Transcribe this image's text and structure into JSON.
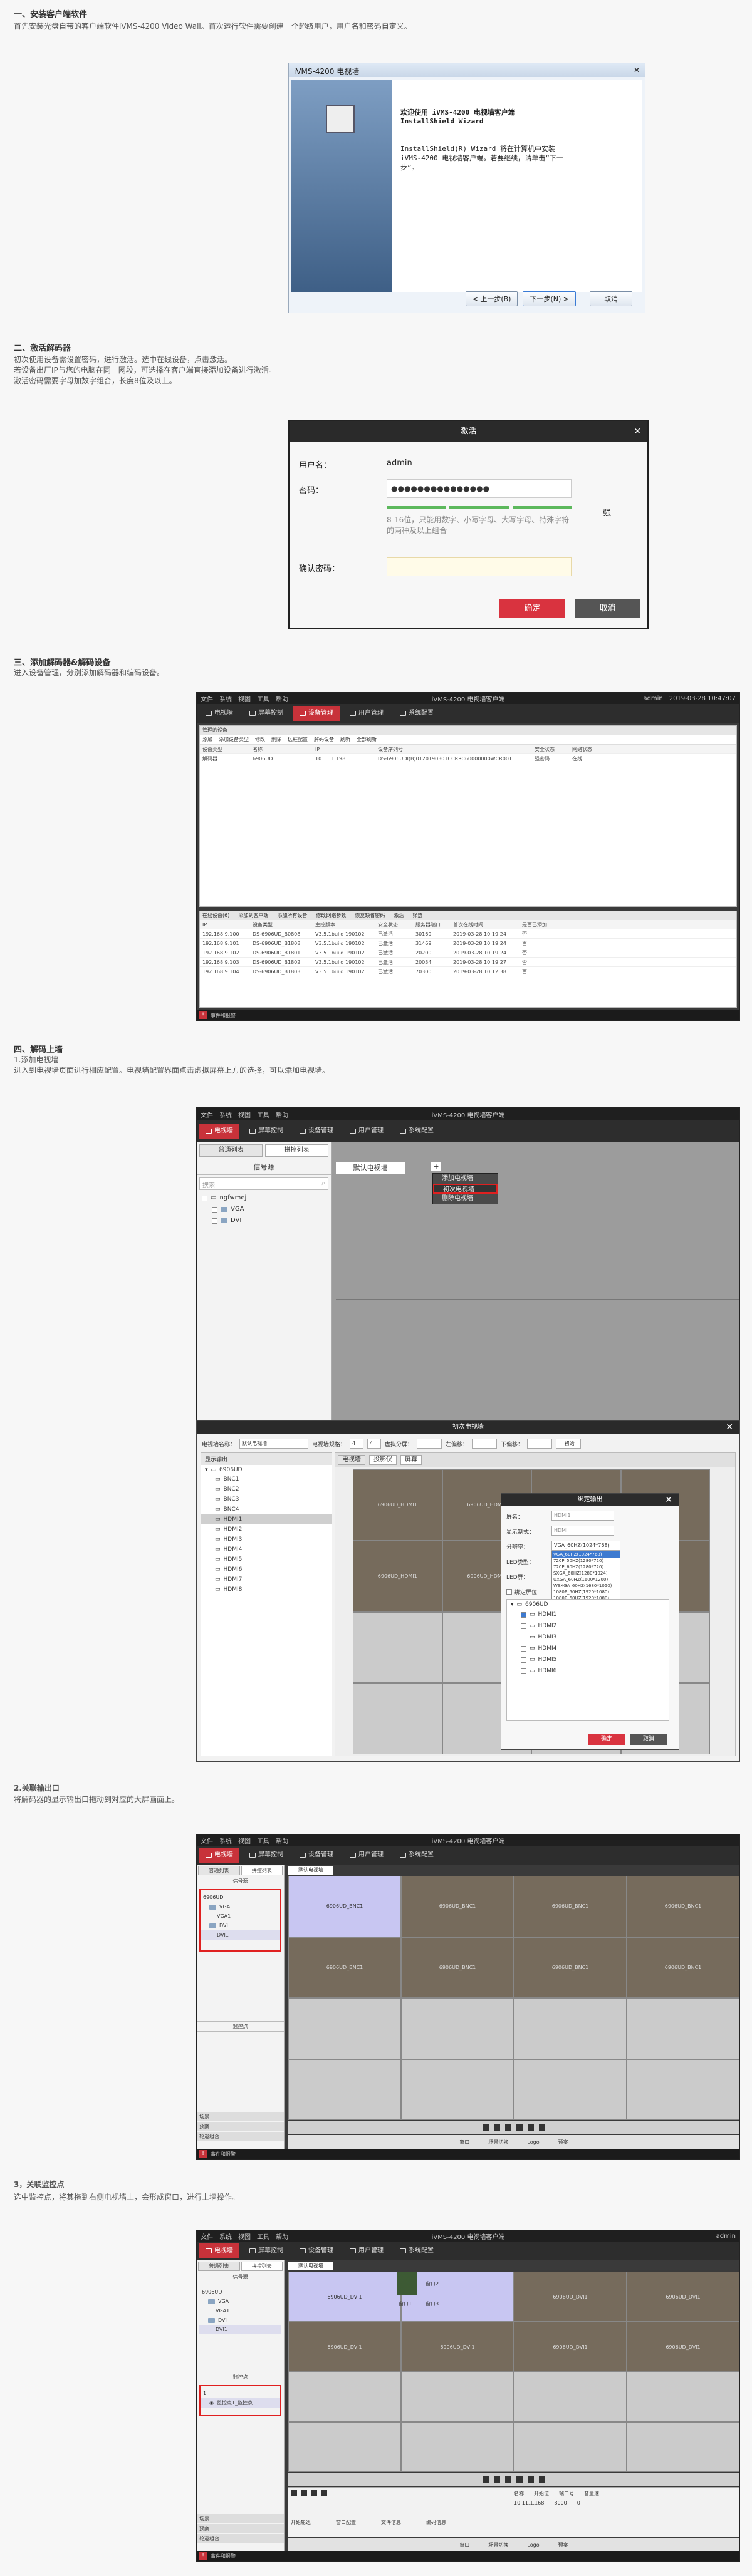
{
  "section1": {
    "heading": "一、安装客户端软件",
    "desc": "首先安装光盘自带的客户端软件iVMS-4200 Video Wall。首次运行软件需要创建一个超级用户，用户名和密码自定义。",
    "installer": {
      "title": "iVMS-4200 电视墙",
      "close": "✕",
      "welcome": "欢迎使用 iVMS-4200 电视墙客户端 InstallShield Wizard",
      "body": "InstallShield(R) Wizard 将在计算机中安装 iVMS-4200 电视墙客户端。若要继续，请单击“下一步”。",
      "back": "< 上一步(B)",
      "next": "下一步(N) >",
      "cancel": "取消"
    }
  },
  "section2": {
    "heading": "二、激活解码器",
    "desc1": "初次使用设备需设置密码，进行激活。选中在线设备，点击激活。",
    "desc2": "若设备出厂IP与您的电脑在同一网段，可选择在客户端直接添加设备进行激活。",
    "desc3": "激活密码需要字母加数字组合，长度8位及以上。",
    "dialog": {
      "title": "激活",
      "close": "✕",
      "user_label": "用户名：",
      "user_value": "admin",
      "pwd_label": "密码：",
      "pwd_value": "●●●●●●●●●●●●●●●",
      "strength": "强",
      "hint": "8-16位，只能用数字、小写字母、大写字母、特殊字符的两种及以上组合",
      "confirm_label": "确认密码：",
      "ok": "确定",
      "cancel": "取消"
    }
  },
  "section3": {
    "heading": "三、添加解码器&解码设备",
    "desc": "进入设备管理，分别添加解码器和编码设备。",
    "app": {
      "menu": [
        "文件",
        "系统",
        "视图",
        "工具",
        "帮助"
      ],
      "title": "iVMS-4200 电视墙客户端",
      "user": "admin",
      "time": "2019-03-28 10:47:07",
      "nav": [
        "电视墙",
        "屏幕控制",
        "设备管理",
        "用户管理",
        "系统配置"
      ],
      "upper_tab": "管理的设备",
      "upper_buttons": [
        "添加",
        "添加设备类型",
        "修改",
        "删除",
        "远程配置",
        "解码设备",
        "刷新",
        "全部刷新"
      ],
      "upper_headers": [
        "设备类型",
        "名称",
        "IP",
        "设备序列号",
        "安全状态",
        "网络状态"
      ],
      "upper_rows": [
        [
          "解码器",
          "6906UD",
          "10.11.1.198",
          "DS-6906UDI(B)0120190301CCRRC60000000WCR001",
          "强密码",
          "在线"
        ]
      ],
      "lower_tab": "在线设备(6)",
      "lower_buttons": [
        "添加到客户端",
        "添加所有设备",
        "修改网络参数",
        "恢复缺省密码",
        "激活",
        "筛选"
      ],
      "lower_headers": [
        "IP",
        "设备类型",
        "主控版本",
        "安全状态",
        "服务器端口",
        "首次在线时间",
        "是否已添加"
      ],
      "lower_rows": [
        [
          "192.168.9.100",
          "DS-6906UD_B0808",
          "V3.5.1build 190102",
          "已激活",
          "30169",
          "2019-03-28 10:19:24",
          "否"
        ],
        [
          "192.168.9.101",
          "DS-6906UD_B1808",
          "V3.5.1build 190102",
          "已激活",
          "31469",
          "2019-03-28 10:19:24",
          "否"
        ],
        [
          "192.168.9.102",
          "DS-6906UD_B1801",
          "V3.5.1build 190102",
          "已激活",
          "20200",
          "2019-03-28 10:19:24",
          "否"
        ],
        [
          "192.168.9.103",
          "DS-6906UD_B1802",
          "V3.5.1build 190102",
          "已激活",
          "20034",
          "2019-03-28 10:19:27",
          "否"
        ],
        [
          "192.168.9.104",
          "DS-6906UD_B1803",
          "V3.5.1build 190102",
          "已激活",
          "70300",
          "2019-03-28 10:12:38",
          "否"
        ]
      ],
      "footer": "事件和报警"
    }
  },
  "section4": {
    "heading": "四、解码上墙",
    "sub1": "1.添加电视墙",
    "desc1": "进入到电视墙页面进行相应配置。电视墙配置界面点击虚拟屏幕上方的选择，可以添加电视墙。",
    "wall": {
      "menu": [
        "文件",
        "系统",
        "视图",
        "工具",
        "帮助"
      ],
      "title": "iVMS-4200 电视墙客户端",
      "nav": [
        "电视墙",
        "屏幕控制",
        "设备管理",
        "用户管理",
        "系统配置"
      ],
      "tabs": [
        "普通列表",
        "拼控列表"
      ],
      "signal": "信号源",
      "search": "搜索",
      "tree": [
        "ngfwmej",
        "VGA",
        "DVI"
      ],
      "wall_tab": "默认电视墙",
      "add": "+",
      "ctx": [
        "添加电视墙",
        "初次电视墙",
        "删除电视墙"
      ]
    },
    "init": {
      "title": "初次电视墙",
      "close": "✕",
      "name_label": "电视墙名称：",
      "name_value": "默认电视墙",
      "size_label": "电视墙规格：",
      "rows": "4",
      "cols": "4",
      "layout_label": "虚拟分屏：",
      "top_label": "左偏移：",
      "bottom_label": "下偏移：",
      "init_button": "初始",
      "tree_title": "显示输出",
      "device": "6906UD",
      "outputs": [
        "BNC1",
        "BNC2",
        "BNC3",
        "BNC4",
        "HDMI1",
        "HDMI2",
        "HDMI3",
        "HDMI4",
        "HDMI5",
        "HDMI6",
        "HDMI7",
        "HDMI8"
      ],
      "tabs": [
        "电视墙",
        "投影仪",
        "屏幕"
      ],
      "cell_label": "6906UD_HDMI1",
      "submodal": {
        "title": "绑定输出",
        "close": "✕",
        "name_label": "屏名：",
        "name_value": "HDMI1",
        "mode_label": "显示制式：",
        "mode_value": "HDMI",
        "res_label": "分辨率：",
        "res_value": "VGA_60HZ(1024*768)",
        "led_label": "LED类型：",
        "led2_label": "LED屏：",
        "bind_label": "绑定屏位",
        "res_options": [
          "VGA_60HZ(1024*768)",
          "720P_50HZ(1280*720)",
          "720P_60HZ(1280*720)",
          "SXGA_60HZ(1280*1024)",
          "UXGA_60HZ(1600*1200)",
          "WSXGA_60HZ(1680*1050)",
          "1080P_50HZ(1920*1080)",
          "1080P_60HZ(1920*1080)",
          "4K_30HZ(3840*2160)"
        ],
        "device": "6906UD",
        "hdmis": [
          "HDMI1",
          "HDMI2",
          "HDMI3",
          "HDMI4",
          "HDMI5",
          "HDMI6"
        ],
        "ok": "确定",
        "cancel": "取消"
      }
    },
    "sub2": "2.关联输出口",
    "desc2": "将解码器的显示输出口拖动到对应的大屏画面上。",
    "bind": {
      "menu": [
        "文件",
        "系统",
        "视图",
        "工具",
        "帮助"
      ],
      "title": "iVMS-4200 电视墙客户端",
      "nav": [
        "电视墙",
        "屏幕控制",
        "设备管理",
        "用户管理",
        "系统配置"
      ],
      "tabs": [
        "普通列表",
        "拼控列表"
      ],
      "signal": "信号源",
      "tree": [
        "6906UD",
        "VGA",
        "VGA1",
        "DVI",
        "DVI1"
      ],
      "wall_tab": "默认电视墙",
      "cell_label": "6906UD_BNC1",
      "bottom_tabs": [
        "窗口",
        "场景切换",
        "Logo",
        "预案"
      ],
      "side_titles": [
        "监控点",
        "场景",
        "预案",
        "轮巡组合"
      ],
      "footer": "事件和报警"
    },
    "sub3": "3，关联监控点",
    "desc3": "选中监控点，将其拖到右侧电视墙上，会形成窗口，进行上墙操作。",
    "cam": {
      "menu": [
        "文件",
        "系统",
        "视图",
        "工具",
        "帮助"
      ],
      "title": "iVMS-4200 电视墙客户端",
      "user": "admin",
      "nav": [
        "电视墙",
        "屏幕控制",
        "设备管理",
        "用户管理",
        "系统配置"
      ],
      "tabs": [
        "普通列表",
        "拼控列表"
      ],
      "signal": "信号源",
      "tree": [
        "6906UD",
        "VGA",
        "VGA1",
        "DVI",
        "DVI1"
      ],
      "monitor": "监控点",
      "cam_tree": [
        "1",
        "监控点1_监控点"
      ],
      "wall_tab": "默认电视墙",
      "cell_label": "6906UD_DVI1",
      "win_labels": [
        "窗口1",
        "窗口2",
        "窗口3"
      ],
      "panel_headers": [
        "名称",
        "开始位",
        "端口号",
        "音量速"
      ],
      "panel_row": [
        "10.11.1.168",
        "8000",
        "0"
      ],
      "bottom_buttons": [
        "开始轮巡",
        "窗口配置",
        "文件信息",
        "编码信息"
      ],
      "bottom_tabs": [
        "窗口",
        "场景切换",
        "Logo",
        "预案"
      ],
      "side_titles": [
        "场景",
        "预案",
        "轮巡组合"
      ],
      "footer": "事件和报警"
    }
  },
  "colors": {
    "accent": "#c8323a",
    "brown": "#766b5c",
    "lilac": "#c8c6f2"
  }
}
